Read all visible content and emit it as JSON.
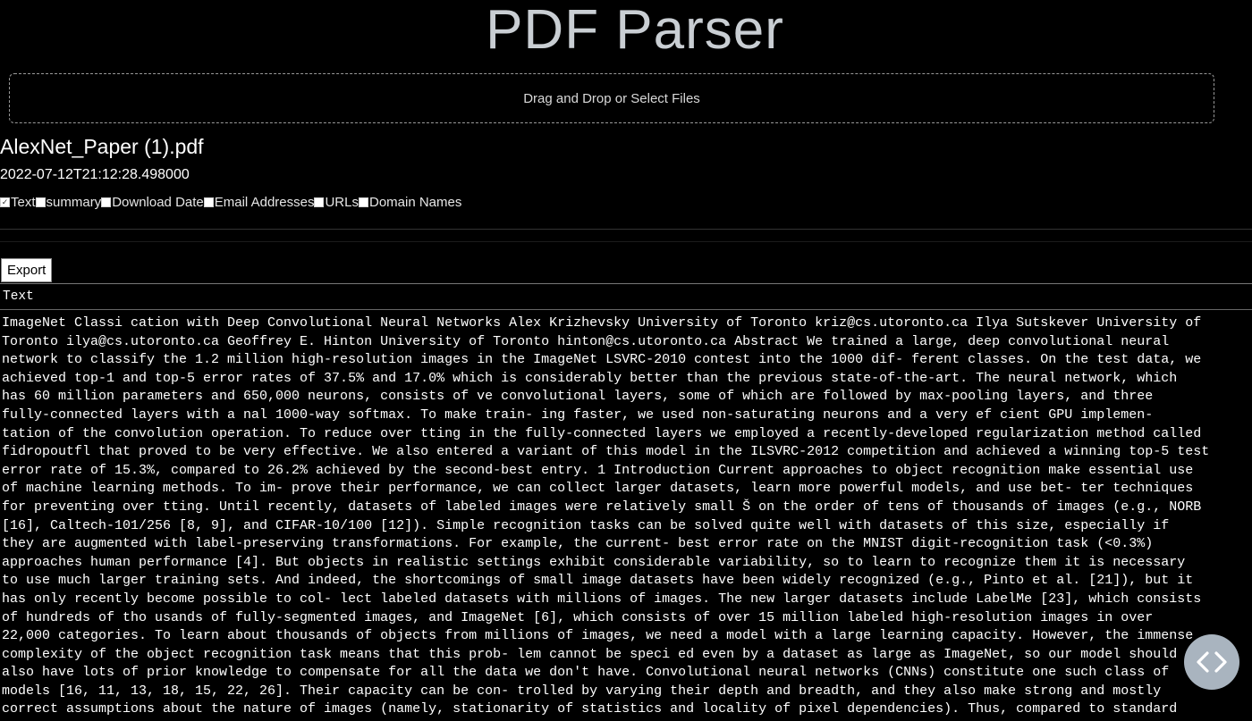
{
  "app_title": "PDF Parser",
  "upload": {
    "label": "Drag and Drop or Select Files"
  },
  "file": {
    "name": "AlexNet_Paper (1).pdf",
    "date": "2022-07-12T21:12:28.498000"
  },
  "options": [
    {
      "label": "Text",
      "checked": true
    },
    {
      "label": "summary",
      "checked": false
    },
    {
      "label": "Download Date",
      "checked": false
    },
    {
      "label": "Email Addresses",
      "checked": false
    },
    {
      "label": "URLs",
      "checked": false
    },
    {
      "label": "Domain Names",
      "checked": false
    }
  ],
  "export_label": "Export",
  "table": {
    "header": "Text",
    "lines": [
      "ImageNet Classi cation with Deep Convolutional Neural Networks Alex Krizhevsky University of Toronto kriz@cs.utoronto.ca Ilya Sutskever University of",
      "Toronto ilya@cs.utoronto.ca Geoffrey E. Hinton University of Toronto hinton@cs.utoronto.ca Abstract We trained a large, deep convolutional neural",
      "network to classify the 1.2 million high-resolution images in the ImageNet LSVRC-2010 contest into the 1000 dif- ferent classes. On the test data, we",
      "achieved top-1 and top-5 error rates of 37.5% and 17.0% which is considerably better than the previous state-of-the-art. The neural network, which",
      "has 60 million parameters and 650,000 neurons, consists of  ve convolutional layers, some of which are followed by max-pooling layers, and three",
      "fully-connected layers with a  nal 1000-way softmax. To make train- ing faster, we used non-saturating neurons and a very ef cient GPU implemen-",
      "tation of the convolution operation. To reduce over tting in the fully-connected layers we employed a recently-developed regularization method called",
      "fidropoutfl that proved to be very effective. We also entered a variant of this model in the ILSVRC-2012 competition and achieved a winning top-5 test",
      "error rate of 15.3%, compared to 26.2% achieved by the second-best entry. 1 Introduction Current approaches to object recognition make essential use",
      "of machine learning methods. To im- prove their performance, we can collect larger datasets, learn more powerful models, and use bet- ter techniques",
      "for preventing over tting. Until recently, datasets of labeled images were relatively small Š on the order of tens of thousands of images (e.g., NORB",
      "[16], Caltech-101/256 [8, 9], and CIFAR-10/100 [12]). Simple recognition tasks can be solved quite well with datasets of this size, especially if",
      "they are augmented with label-preserving transformations. For example, the current- best error rate on the MNIST digit-recognition task (<0.3%)",
      "approaches human performance [4]. But objects in realistic settings exhibit considerable variability, so to learn to recognize them it is necessary",
      "to use much larger training sets. And indeed, the shortcomings of small image datasets have been widely recognized (e.g., Pinto et al. [21]), but it",
      "has only recently become possible to col- lect labeled datasets with millions of images. The new larger datasets include LabelMe [23], which consists",
      "of hundreds of tho usands of fully-segmented images, and ImageNet [6], which consists of over 15 million labeled high-resolution images in over",
      "22,000 categories. To learn about thousands of objects from millions of images, we need a model with a large learning capacity. However, the immense",
      "complexity of the object recognition task means that this prob- lem cannot be speci ed even by a dataset as large as ImageNet, so our model should",
      "also have lots of prior knowledge to compensate for all the data we don't have. Convolutional neural networks (CNNs) constitute one such class of",
      "models [16, 11, 13, 18, 15, 22, 26]. Their capacity can be con- trolled by varying their depth and breadth, and they also make strong and mostly",
      "correct assumptions about the nature of images (namely, stationarity of statistics and locality of pixel dependencies). Thus, compared to standard"
    ]
  },
  "fab_icon": "code-brackets-icon"
}
